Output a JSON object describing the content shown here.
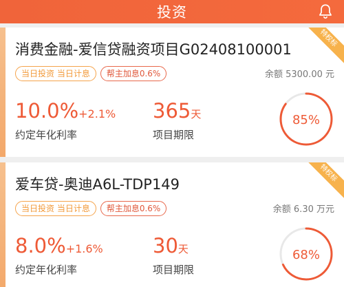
{
  "header": {
    "title": "投资",
    "bell_icon": "bell-icon"
  },
  "products": [
    {
      "name": "消费金融-爱信贷融资项目G02408100001",
      "tag_same_day": "当日投资 当日计息",
      "tag_bonus": "帮主加息0.6%",
      "balance": "余额 5300.00 元",
      "rate_main": "10.0%",
      "rate_bonus": "+2.1%",
      "rate_label": "约定年化利率",
      "term_value": "365",
      "term_unit": "天",
      "term_label": "项目期限",
      "progress_percent": 85,
      "progress_text": "85%",
      "ribbon": "特权标"
    },
    {
      "name": "爱车贷-奥迪A6L-TDP149",
      "tag_same_day": "当日投资 当日计息",
      "tag_bonus": "帮主加息0.6%",
      "balance": "余额 6.30 万元",
      "rate_main": "8.0%",
      "rate_bonus": "+1.6%",
      "rate_label": "约定年化利率",
      "term_value": "30",
      "term_unit": "天",
      "term_label": "项目期限",
      "progress_percent": 68,
      "progress_text": "68%",
      "ribbon": "特权标"
    }
  ],
  "colors": {
    "accent": "#ee5a36",
    "ring_track": "#e8e8e8",
    "ribbon": "#f7b24c"
  }
}
